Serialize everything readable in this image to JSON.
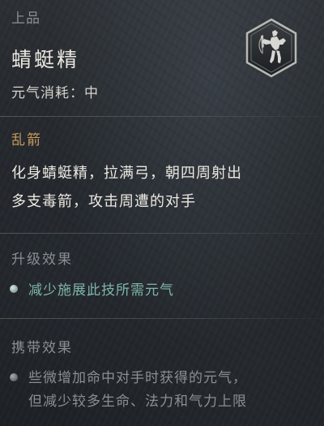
{
  "header": {
    "grade": "上品",
    "title": "蜻蜓精",
    "cost": "元气消耗：中",
    "badge_icon": "transformation-portrait-icon"
  },
  "skill": {
    "name": "乱箭",
    "description_line1": "化身蜻蜓精，拉满弓，朝四周射出",
    "description_line2": "多支毒箭，攻击周遭的对手"
  },
  "upgrade": {
    "heading": "升级效果",
    "effect": "减少施展此技所需元气"
  },
  "carry": {
    "heading": "携带效果",
    "effect_line1": "些微增加命中对手时获得的元气，",
    "effect_line2": "但减少较多生命、法力和气力上限"
  },
  "colors": {
    "section_gold": "#c99a5c",
    "effect_teal": "#7fb6a8",
    "muted_gray": "#8a8e91",
    "main_text": "#ece9e2"
  }
}
